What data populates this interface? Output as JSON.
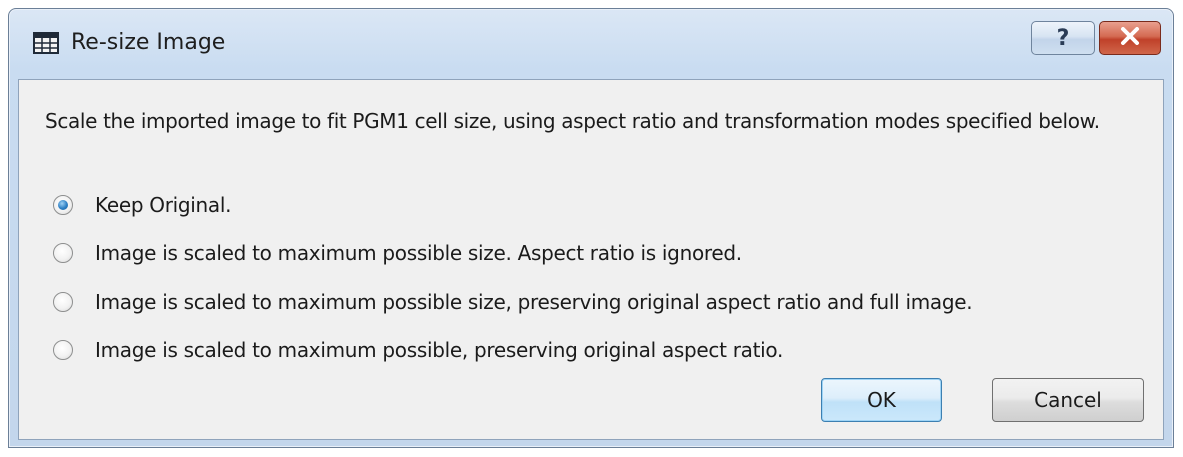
{
  "window": {
    "title": "Re-size Image",
    "title_icon": "table-window-icon",
    "help_label": "?",
    "close_icon": "close-icon"
  },
  "dialog": {
    "message": "Scale the imported image to fit PGM1 cell size, using aspect ratio and transformation modes specified below.",
    "options": [
      {
        "label": "Keep Original.",
        "checked": true
      },
      {
        "label": "Image is scaled to maximum possible size. Aspect ratio is ignored.",
        "checked": false
      },
      {
        "label": "Image is scaled to maximum possible size, preserving original aspect ratio and full image.",
        "checked": false
      },
      {
        "label": "Image is scaled to maximum possible, preserving original aspect ratio.",
        "checked": false
      }
    ],
    "ok_label": "OK",
    "cancel_label": "Cancel"
  },
  "colors": {
    "title_bar": "#c9dcf1",
    "close_button": "#c0412a",
    "dialog_background": "#f0f0f0",
    "selected_radio": "#2d7fc4"
  }
}
